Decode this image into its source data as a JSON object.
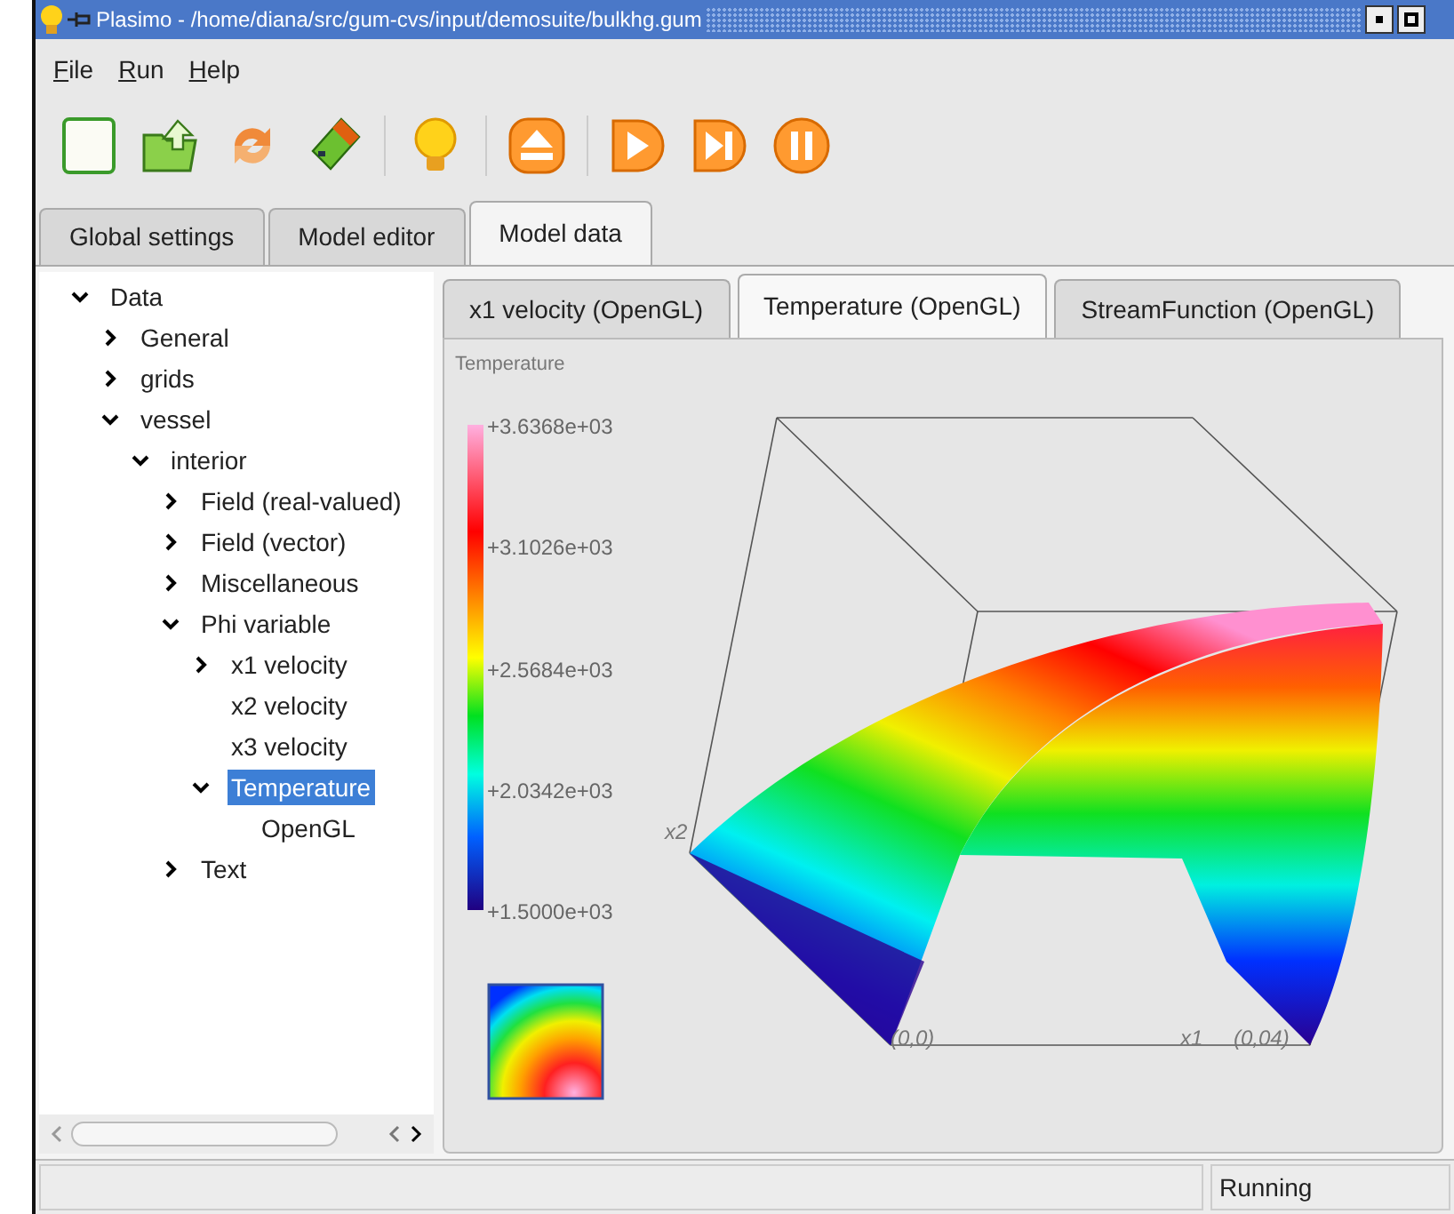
{
  "window": {
    "title": "Plasimo - /home/diana/src/gum-cvs/input/demosuite/bulkhg.gum"
  },
  "menu": [
    "File",
    "Run",
    "Help"
  ],
  "toolbar": [
    {
      "kind": "new"
    },
    {
      "kind": "open"
    },
    {
      "kind": "reload"
    },
    {
      "kind": "stick"
    },
    {
      "kind": "separator"
    },
    {
      "kind": "bulb"
    },
    {
      "kind": "separator"
    },
    {
      "kind": "eject"
    },
    {
      "kind": "separator"
    },
    {
      "kind": "play"
    },
    {
      "kind": "step"
    },
    {
      "kind": "pause"
    }
  ],
  "tabs": [
    {
      "label": "Global settings",
      "selected": false
    },
    {
      "label": "Model editor",
      "selected": false
    },
    {
      "label": "Model data",
      "selected": true
    }
  ],
  "tree": [
    {
      "label": "Data",
      "expanded": true,
      "selected": false,
      "children": [
        {
          "label": "General",
          "expanded": false,
          "selected": false
        },
        {
          "label": "grids",
          "expanded": false,
          "selected": false
        },
        {
          "label": "vessel",
          "expanded": true,
          "selected": false,
          "children": [
            {
              "label": "interior",
              "expanded": true,
              "selected": false,
              "children": [
                {
                  "label": "Field (real-valued)",
                  "expanded": false,
                  "selected": false
                },
                {
                  "label": "Field (vector)",
                  "expanded": false,
                  "selected": false
                },
                {
                  "label": "Miscellaneous",
                  "expanded": false,
                  "selected": false
                },
                {
                  "label": "Phi variable",
                  "expanded": true,
                  "selected": false,
                  "children": [
                    {
                      "label": "x1 velocity",
                      "expanded": false,
                      "selected": false
                    },
                    {
                      "label": "x2 velocity",
                      "selected": false
                    },
                    {
                      "label": "x3 velocity",
                      "selected": false
                    },
                    {
                      "label": "Temperature",
                      "expanded": true,
                      "selected": true,
                      "children": [
                        {
                          "label": "OpenGL",
                          "selected": false
                        }
                      ]
                    }
                  ]
                },
                {
                  "label": "Text",
                  "expanded": false,
                  "selected": false
                }
              ]
            }
          ]
        }
      ]
    }
  ],
  "view_tabs": [
    {
      "label": "x1 velocity (OpenGL)",
      "selected": false
    },
    {
      "label": "Temperature (OpenGL)",
      "selected": true
    },
    {
      "label": "StreamFunction (OpenGL)",
      "selected": false
    }
  ],
  "plot": {
    "title": "Temperature",
    "legend_labels": [
      "+3.6368e+03",
      "+3.1026e+03",
      "+2.5684e+03",
      "+2.0342e+03",
      "+1.5000e+03"
    ],
    "corner_labels": [
      "x2",
      "(0,0)",
      "x1",
      "(0,04)"
    ]
  },
  "status_bar": {
    "status": "Running"
  }
}
